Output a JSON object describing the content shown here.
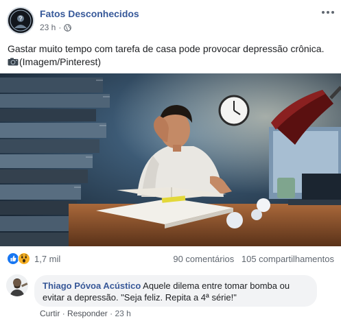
{
  "post": {
    "page_name": "Fatos Desconhecidos",
    "time": "23 h",
    "privacy_icon": "globe-icon",
    "body_text": "Gastar muito tempo com tarefa de casa pode provocar depressão crônica.",
    "photo_credit": "(Imagem/Pinterest)",
    "camera_icon": "camera-icon"
  },
  "reactions": {
    "types": [
      "like",
      "wow"
    ],
    "count": "1,7 mil",
    "comments": "90 comentários",
    "shares": "105 compartilhamentos"
  },
  "comment": {
    "author": "Thiago Póvoa Acústico",
    "text": "Aquele dilema entre tomar bomba ou evitar a depressão. \"Seja feliz. Repita a 4ª série!\"",
    "actions": {
      "like": "Curtir",
      "reply": "Responder",
      "time": "23 h"
    }
  },
  "colors": {
    "page_name": "#365899",
    "like_blue": "#1877f2",
    "wow_yellow": "#f7b125",
    "bubble": "#f2f3f5"
  }
}
